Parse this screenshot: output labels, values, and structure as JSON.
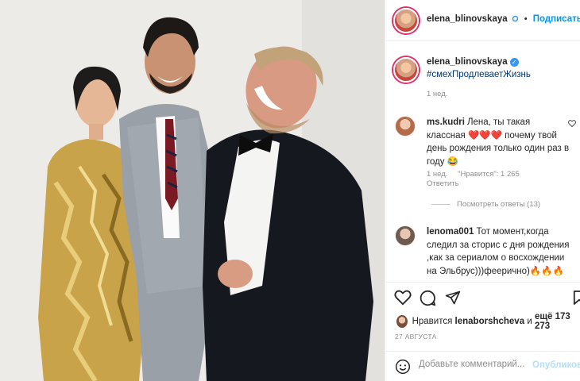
{
  "post": {
    "author": "elena_blinovskaya",
    "follow_label": "Подписаться",
    "separator": "•",
    "caption_hashtag": "#смехПродлеваетЖизнь",
    "caption_time": "1 нед."
  },
  "comments": [
    {
      "user": "ms.kudri",
      "text_pre": "Лена, ты такая классная",
      "emoji": "❤️❤️❤️",
      "text_post": " почему твой день рождения только один раз в году 😂",
      "time": "1 нед.",
      "likes": "\"Нравится\": 1 265",
      "reply": "Ответить",
      "view_replies": "Посмотреть ответы (13)"
    },
    {
      "user": "lenoma001",
      "text": "Тот момент,когда следил за сторис с дня рождения ,как за сериалом о восхождении на Эльбрус)))феерично)🔥🔥🔥"
    }
  ],
  "likes": {
    "prefix": "Нравится",
    "user": "lenaborshcheva",
    "conj": "и",
    "more": "ещё 173 273"
  },
  "date": "27 АВГУСТА",
  "add_comment": {
    "placeholder": "Добавьте комментарий...",
    "publish": "Опубликовать"
  },
  "icons": {
    "heart": "heart-icon",
    "comment": "comment-icon",
    "share": "share-icon",
    "bookmark": "bookmark-icon",
    "emoji": "emoji-icon",
    "verified": "verified-icon"
  },
  "colors": {
    "link": "#0095f6",
    "hashtag": "#00376b",
    "muted": "#8e8e8e",
    "verified": "#3897f0"
  }
}
